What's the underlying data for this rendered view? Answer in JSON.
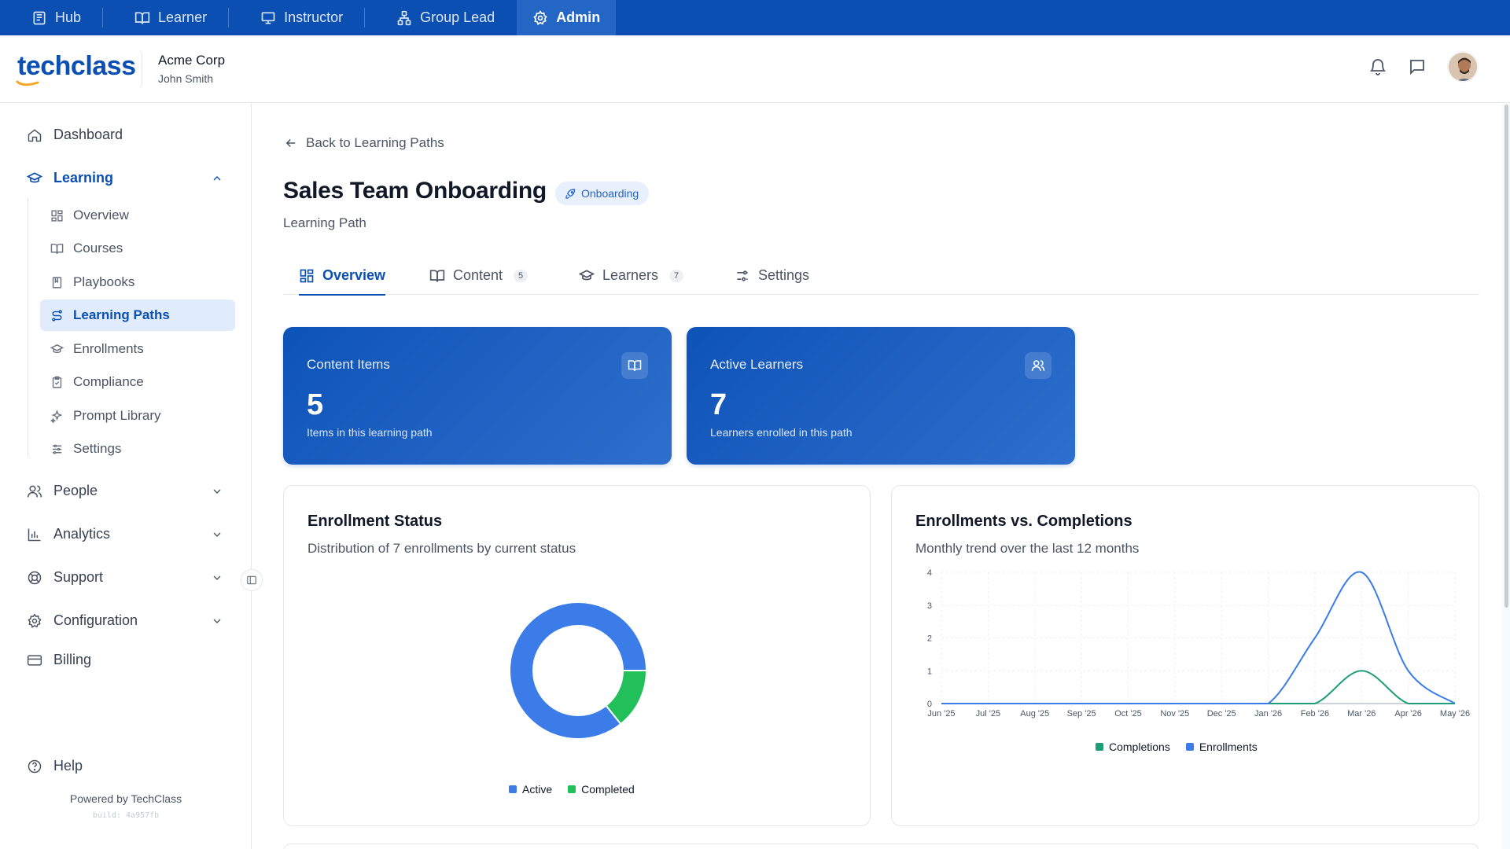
{
  "topbar": {
    "roles": [
      {
        "label": "Hub",
        "icon": "hub-icon"
      },
      {
        "label": "Learner",
        "icon": "book-open-icon"
      },
      {
        "label": "Instructor",
        "icon": "presentation-icon"
      },
      {
        "label": "Group Lead",
        "icon": "group-icon"
      },
      {
        "label": "Admin",
        "icon": "gear-icon",
        "active": true
      }
    ]
  },
  "header": {
    "logo_text": "techclass",
    "org_name": "Acme Corp",
    "user_name": "John Smith"
  },
  "sidebar": {
    "items": [
      {
        "label": "Dashboard"
      },
      {
        "label": "Learning",
        "expanded": true
      },
      {
        "label": "People"
      },
      {
        "label": "Analytics"
      },
      {
        "label": "Support"
      },
      {
        "label": "Configuration"
      },
      {
        "label": "Billing"
      },
      {
        "label": "Help"
      }
    ],
    "learning_sub": [
      {
        "label": "Overview"
      },
      {
        "label": "Courses"
      },
      {
        "label": "Playbooks"
      },
      {
        "label": "Learning Paths",
        "active": true
      },
      {
        "label": "Enrollments"
      },
      {
        "label": "Compliance"
      },
      {
        "label": "Prompt Library"
      },
      {
        "label": "Settings"
      }
    ],
    "powered_by": "Powered by TechClass",
    "build": "build: 4a957fb"
  },
  "page": {
    "back_label": "Back to Learning Paths",
    "title": "Sales Team Onboarding",
    "badge": "Onboarding",
    "subtitle": "Learning Path"
  },
  "tabs": [
    {
      "label": "Overview",
      "active": true
    },
    {
      "label": "Content",
      "count": "5"
    },
    {
      "label": "Learners",
      "count": "7"
    },
    {
      "label": "Settings"
    }
  ],
  "stats": [
    {
      "label": "Content Items",
      "value": "5",
      "desc": "Items in this learning path",
      "icon": "book-open-icon"
    },
    {
      "label": "Active Learners",
      "value": "7",
      "desc": "Learners enrolled in this path",
      "icon": "users-icon"
    }
  ],
  "enrollment_status": {
    "title": "Enrollment Status",
    "subtitle": "Distribution of 7 enrollments by current status",
    "chart_data": {
      "type": "pie",
      "categories": [
        "Active",
        "Completed"
      ],
      "values": [
        6,
        1
      ],
      "colors": [
        "#3b7ce8",
        "#22c05a"
      ]
    }
  },
  "trend": {
    "title": "Enrollments vs. Completions",
    "subtitle": "Monthly trend over the last 12 months",
    "chart_data": {
      "type": "line",
      "categories": [
        "Jun '25",
        "Jul '25",
        "Aug '25",
        "Sep '25",
        "Oct '25",
        "Nov '25",
        "Dec '25",
        "Jan '26",
        "Feb '26",
        "Mar '26",
        "Apr '26",
        "May '26"
      ],
      "series": [
        {
          "name": "Completions",
          "values": [
            0,
            0,
            0,
            0,
            0,
            0,
            0,
            0,
            0,
            1,
            0,
            0
          ],
          "color": "#1f9d77"
        },
        {
          "name": "Enrollments",
          "values": [
            0,
            0,
            0,
            0,
            0,
            0,
            0,
            0,
            2,
            4,
            1,
            0
          ],
          "color": "#3b7ce8"
        }
      ],
      "ylim": [
        0,
        4
      ],
      "yticks": [
        "0",
        "1",
        "2",
        "3",
        "4"
      ],
      "grid": true,
      "legend": "bottom"
    }
  }
}
